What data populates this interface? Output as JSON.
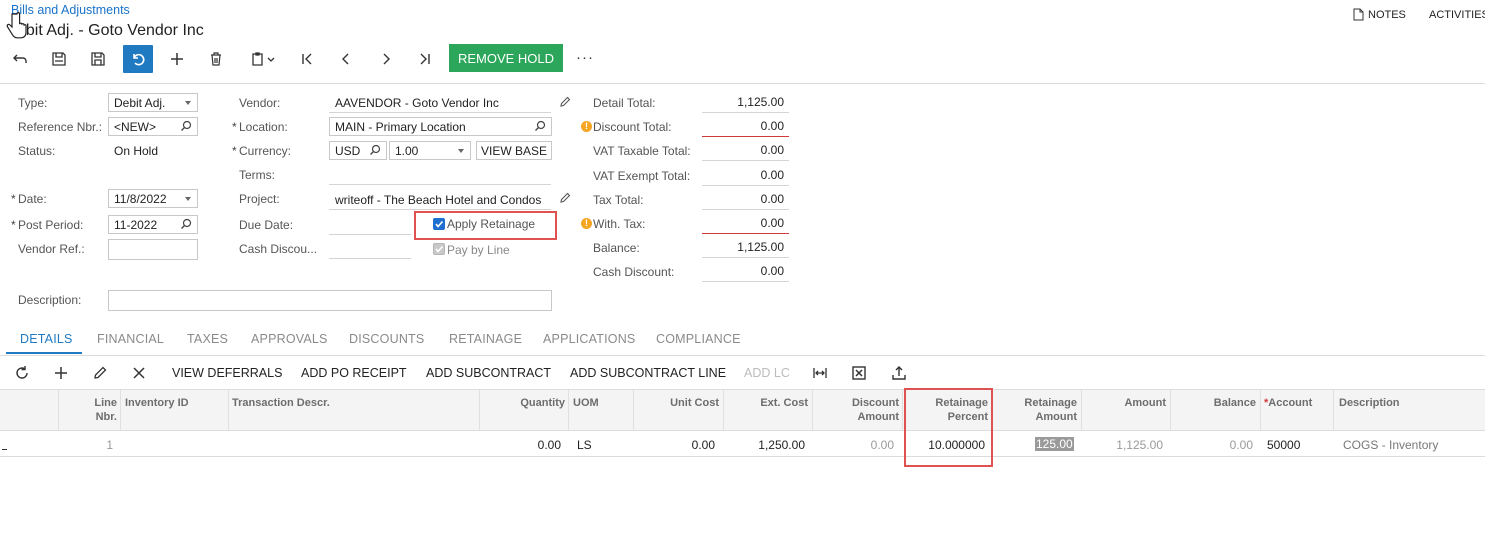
{
  "breadcrumb": "Bills and Adjustments",
  "page_title": "ebit Adj. - Goto Vendor Inc",
  "top_links": {
    "notes": "NOTES",
    "activities": "ACTIVITIES"
  },
  "toolbar": {
    "remove_hold": "REMOVE HOLD",
    "more": "···"
  },
  "form": {
    "type": {
      "label": "Type:",
      "value": "Debit Adj."
    },
    "reference": {
      "label": "Reference Nbr.:",
      "value": "<NEW>"
    },
    "status": {
      "label": "Status:",
      "value": "On Hold"
    },
    "date": {
      "label": "Date:",
      "value": "11/8/2022"
    },
    "post_period": {
      "label": "Post Period:",
      "value": "11-2022"
    },
    "vendor_ref": {
      "label": "Vendor Ref.:",
      "value": ""
    },
    "description": {
      "label": "Description:",
      "value": ""
    },
    "vendor": {
      "label": "Vendor:",
      "value": "AAVENDOR - Goto Vendor Inc"
    },
    "location": {
      "label": "Location:",
      "value": "MAIN - Primary Location"
    },
    "currency": {
      "label": "Currency:",
      "value": "USD",
      "rate": "1.00",
      "view_base": "VIEW BASE"
    },
    "terms": {
      "label": "Terms:"
    },
    "project": {
      "label": "Project:",
      "value": "writeoff - The Beach Hotel and Condos"
    },
    "due_date": {
      "label": "Due Date:"
    },
    "cash_discount_date": {
      "label": "Cash Discou..."
    },
    "apply_retainage": {
      "label": "Apply Retainage",
      "checked": true
    },
    "pay_by_line": {
      "label": "Pay by Line",
      "checked": true
    }
  },
  "totals": [
    {
      "label": "Detail Total:",
      "value": "1,125.00",
      "warn": false,
      "redline": false
    },
    {
      "label": "Discount Total:",
      "value": "0.00",
      "warn": true,
      "redline": true
    },
    {
      "label": "VAT Taxable Total:",
      "value": "0.00",
      "warn": false,
      "redline": false
    },
    {
      "label": "VAT Exempt Total:",
      "value": "0.00",
      "warn": false,
      "redline": false
    },
    {
      "label": "Tax Total:",
      "value": "0.00",
      "warn": false,
      "redline": false
    },
    {
      "label": "With. Tax:",
      "value": "0.00",
      "warn": true,
      "redline": true
    },
    {
      "label": "Balance:",
      "value": "1,125.00",
      "warn": false,
      "redline": false
    },
    {
      "label": "Cash Discount:",
      "value": "0.00",
      "warn": false,
      "redline": false
    }
  ],
  "tabs": [
    "DETAILS",
    "FINANCIAL",
    "TAXES",
    "APPROVALS",
    "DISCOUNTS",
    "RETAINAGE",
    "APPLICATIONS",
    "COMPLIANCE"
  ],
  "grid_toolbar": {
    "view_deferrals": "VIEW DEFERRALS",
    "add_po_receipt": "ADD PO RECEIPT",
    "add_subcontract": "ADD SUBCONTRACT",
    "add_subcontract_line": "ADD SUBCONTRACT LINE",
    "add_lc": "ADD LC"
  },
  "grid": {
    "headers": {
      "line_nbr": [
        "Line",
        "Nbr."
      ],
      "inventory_id": "Inventory ID",
      "transaction_descr": "Transaction Descr.",
      "quantity": "Quantity",
      "uom": "UOM",
      "unit_cost": "Unit Cost",
      "ext_cost": "Ext. Cost",
      "discount_amount": [
        "Discount",
        "Amount"
      ],
      "retainage_percent": [
        "Retainage",
        "Percent"
      ],
      "retainage_amount": [
        "Retainage",
        "Amount"
      ],
      "amount": "Amount",
      "balance": "Balance",
      "account": "Account",
      "description": "Description"
    },
    "rows": [
      {
        "line_nbr": "1",
        "inventory_id": "",
        "transaction_descr": "",
        "quantity": "0.00",
        "uom": "LS",
        "unit_cost": "0.00",
        "ext_cost": "1,250.00",
        "discount_amount": "0.00",
        "retainage_percent": "10.000000",
        "retainage_amount": "125.00",
        "amount": "1,125.00",
        "balance": "0.00",
        "account": "50000",
        "description": "COGS - Inventory"
      }
    ]
  },
  "colors": {
    "accent": "#1f7ac2",
    "hold_button": "#2ca65a",
    "highlight": "#e05252",
    "warning": "#f5a623"
  }
}
